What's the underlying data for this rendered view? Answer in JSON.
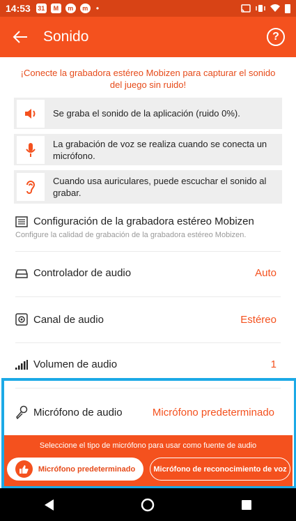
{
  "status_bar": {
    "time": "14:53",
    "calendar_day": "31",
    "icons": [
      "calendar-icon",
      "gmail-icon",
      "mobizen-icon",
      "mobizen-icon",
      "dot-icon",
      "cast-icon",
      "vibrate-icon",
      "wifi-icon",
      "battery-icon"
    ]
  },
  "app_bar": {
    "title": "Sonido"
  },
  "notice": "¡Conecte la grabadora estéreo Mobizen para capturar el sonido del juego sin ruido!",
  "info_cards": [
    {
      "icon": "speaker-icon",
      "text": "Se graba el sonido de la aplicación (ruido 0%)."
    },
    {
      "icon": "microphone-icon",
      "text": "La grabación de voz se realiza cuando se conecta un micrófono."
    },
    {
      "icon": "ear-icon",
      "text": "Cuando usa auriculares, puede escuchar el sonido al grabar."
    }
  ],
  "stereo_recorder": {
    "title": "Configuración de la grabadora estéreo Mobizen",
    "subtitle": "Configure la calidad de grabación de la grabadora estéreo Mobizen."
  },
  "settings": [
    {
      "label": "Controlador de audio",
      "value": "Auto"
    },
    {
      "label": "Canal de audio",
      "value": "Estéreo"
    },
    {
      "label": "Volumen de audio",
      "value": "1"
    },
    {
      "label": "Micrófono de audio",
      "value": "Micrófono predeterminado"
    }
  ],
  "mic_picker": {
    "hint": "Seleccione el tipo de micrófono para usar como fuente de audio",
    "option_default": "Micrófono predeterminado",
    "option_voice": "Micrófono de reconocimiento de voz"
  },
  "colors": {
    "accent": "#f4511e",
    "status_bar": "#d84315",
    "highlight": "#1ca9e6"
  }
}
